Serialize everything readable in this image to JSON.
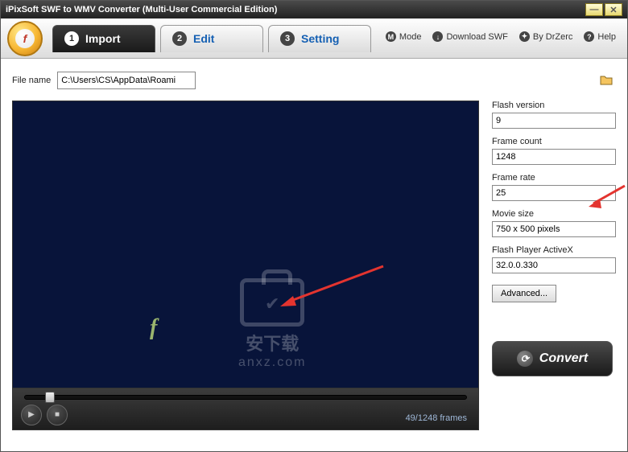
{
  "titlebar": {
    "title": "iPixSoft SWF to WMV Converter (Multi-User Commercial Edition)"
  },
  "tabs": [
    {
      "num": "1",
      "label": "Import"
    },
    {
      "num": "2",
      "label": "Edit"
    },
    {
      "num": "3",
      "label": "Setting"
    }
  ],
  "menu": {
    "mode": "Mode",
    "download": "Download SWF",
    "by": "By DrZerc",
    "help": "Help"
  },
  "file": {
    "label": "File name",
    "value": "C:\\Users\\CS\\AppData\\Roaming\\iPixSoft\\SWF to WMV Converter\\Sample.swf"
  },
  "watermark": {
    "text1": "安下载",
    "text2": "anxz.com"
  },
  "playback": {
    "frames_display": "49/1248 frames"
  },
  "info": {
    "flash_version": {
      "label": "Flash version",
      "value": "9"
    },
    "frame_count": {
      "label": "Frame count",
      "value": "1248"
    },
    "frame_rate": {
      "label": "Frame rate",
      "value": "25"
    },
    "movie_size": {
      "label": "Movie size",
      "value": "750 x 500 pixels"
    },
    "activex": {
      "label": "Flash Player ActiveX",
      "value": "32.0.0.330"
    },
    "advanced": "Advanced..."
  },
  "convert": {
    "label": "Convert"
  }
}
